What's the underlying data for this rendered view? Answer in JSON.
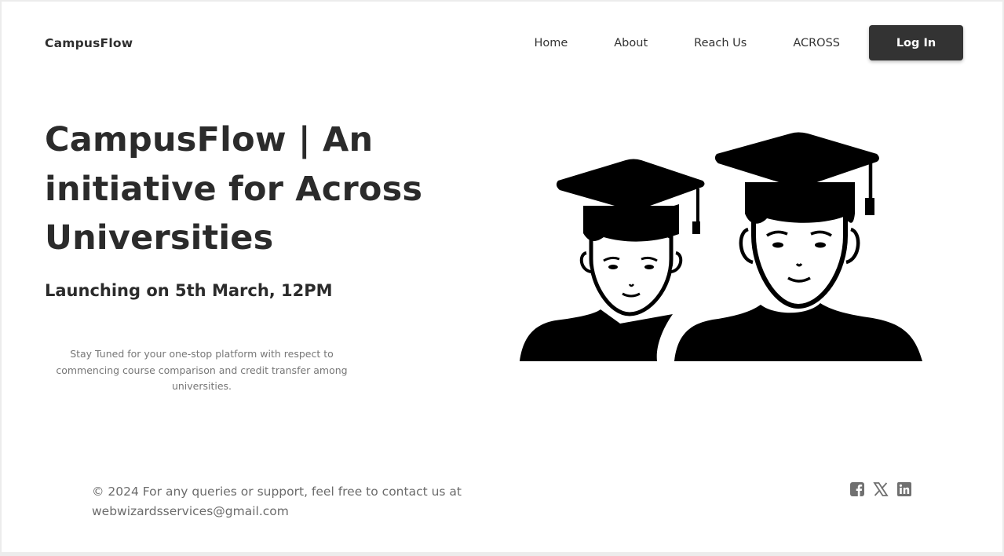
{
  "header": {
    "brand": "CampusFlow",
    "nav": [
      {
        "label": "Home"
      },
      {
        "label": "About"
      },
      {
        "label": "Reach Us"
      },
      {
        "label": "ACROSS"
      }
    ],
    "login_label": "Log In"
  },
  "hero": {
    "title": "CampusFlow | An initiative for Across Universities",
    "launch": "Launching on 5th March, 12PM",
    "description": "Stay Tuned for your one-stop platform with respect to commencing course comparison and credit transfer among universities."
  },
  "footer": {
    "text": "© 2024 For any queries or support, feel free to contact us at webwizardsservices@gmail.com",
    "social_icons": [
      "facebook-icon",
      "x-icon",
      "linkedin-icon"
    ]
  },
  "colors": {
    "text": "#2b2b2b",
    "button_bg": "#333333",
    "muted": "#777777",
    "icon": "#707070"
  }
}
